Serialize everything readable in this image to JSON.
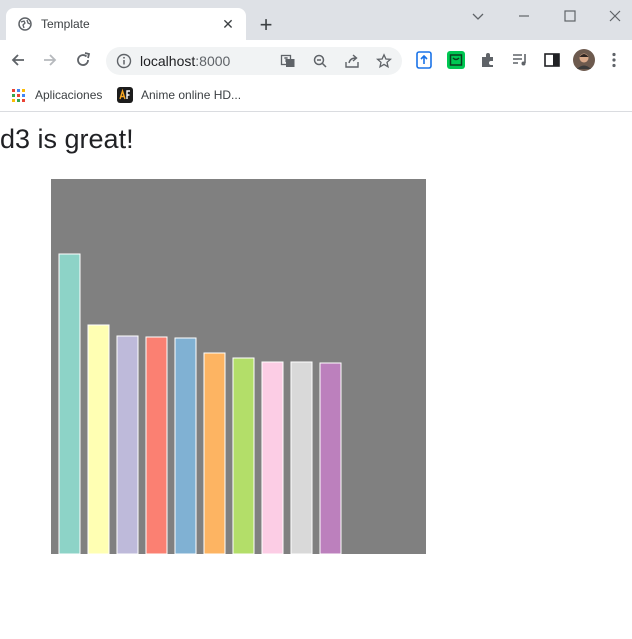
{
  "browser": {
    "tab": {
      "title": "Template"
    },
    "window_controls": [
      "minimize-icon",
      "maximize-icon",
      "close-icon"
    ],
    "address_bar": {
      "url_host": "localhost",
      "url_port": ":8000"
    },
    "bookmarks": [
      {
        "label": "Aplicaciones",
        "icon": "apps-grid-icon"
      },
      {
        "label": "Anime online HD...",
        "icon": "animeflv-icon"
      }
    ]
  },
  "page": {
    "heading": "d3 is great!"
  },
  "colors": {
    "chart_background": "#808080",
    "bar_stroke": "#ffffff",
    "bars": [
      "#8dd3c7",
      "#ffffb3",
      "#bebada",
      "#fb8072",
      "#80b1d3",
      "#fdb462",
      "#b3de69",
      "#fccde5",
      "#d9d9d9",
      "#bc80bd"
    ]
  },
  "chart_data": {
    "type": "bar",
    "title": "",
    "xlabel": "",
    "ylabel": "",
    "ylim": [
      0,
      375
    ],
    "grid": false,
    "values": [
      300,
      229,
      218,
      217,
      216,
      201,
      196,
      192,
      192,
      191
    ]
  }
}
